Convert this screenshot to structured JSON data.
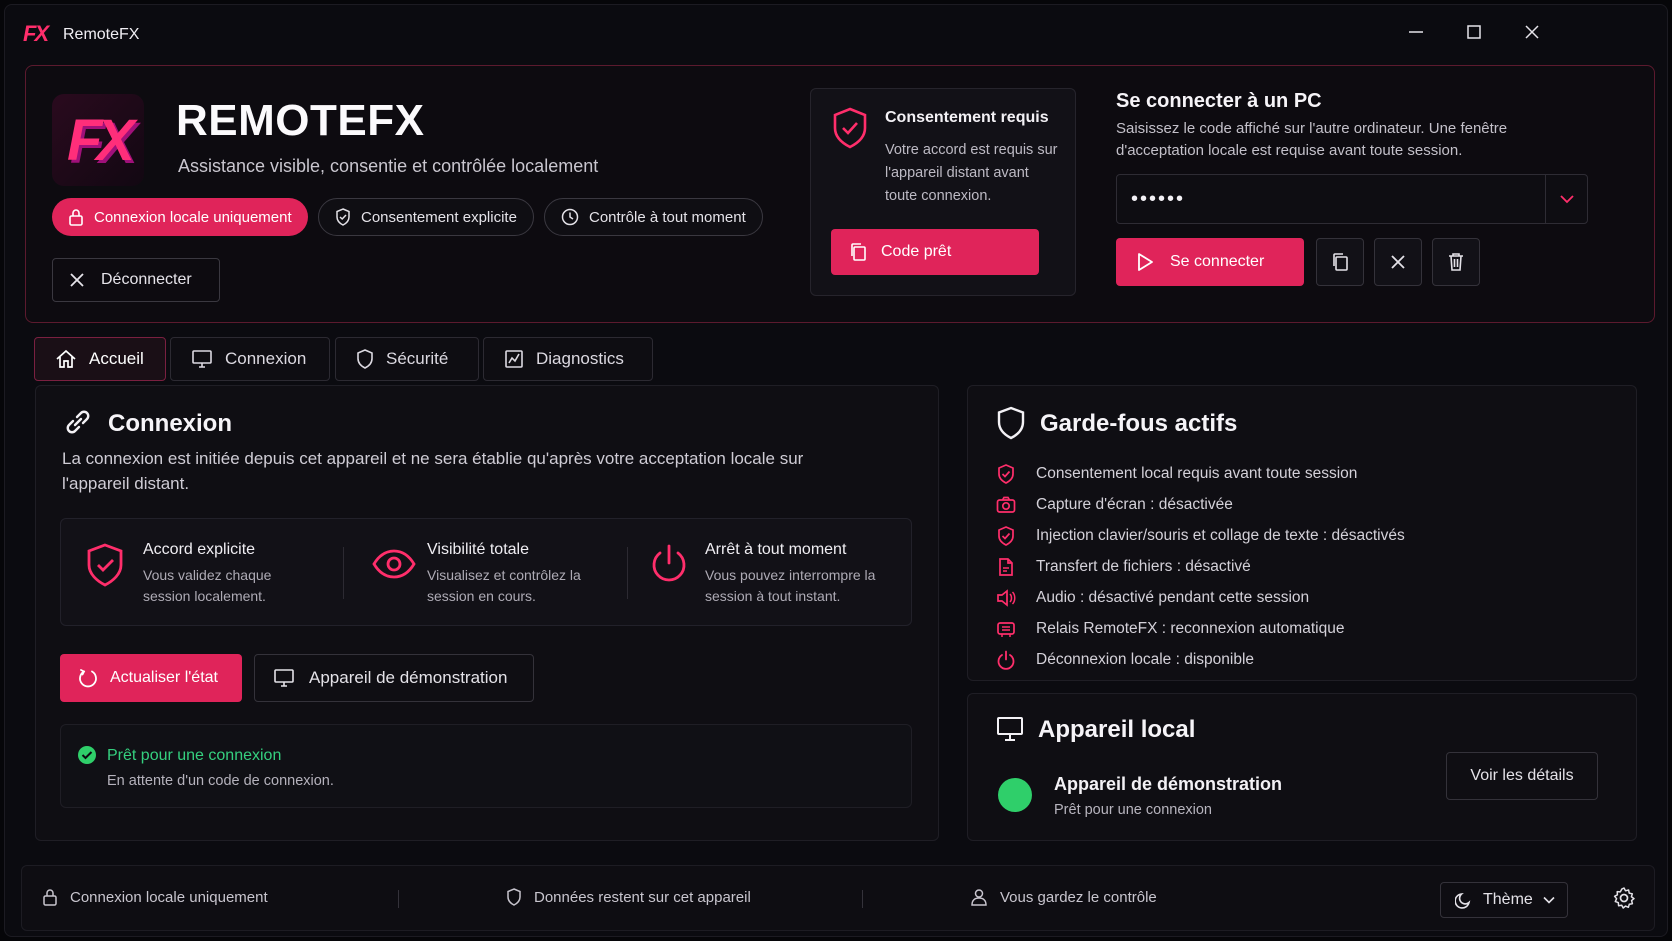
{
  "window": {
    "title": "RemoteFX",
    "logo_text": "FX"
  },
  "hero": {
    "logo_text": "FX",
    "brand": "REMOTEFX",
    "tagline": "Assistance visible, consentie et contrôlée localement",
    "pills": [
      "Connexion locale uniquement",
      "Consentement explicite",
      "Contrôle à tout moment"
    ],
    "disconnect_label": "Déconnecter"
  },
  "consent": {
    "title": "Consentement requis",
    "desc": "Votre accord est requis sur l'appareil distant avant toute connexion.",
    "code_button": "Code prêt"
  },
  "connect": {
    "title": "Se connecter à un PC",
    "desc": "Saisissez le code affiché sur l'autre ordinateur. Une fenêtre d'acceptation locale est requise avant toute session.",
    "code_value": "••••••",
    "button": "Se connecter"
  },
  "tabs": [
    "Accueil",
    "Connexion",
    "Sécurité",
    "Diagnostics"
  ],
  "connexion_panel": {
    "title": "Connexion",
    "desc": "La connexion est initiée depuis cet appareil et ne sera établie qu'après votre acceptation locale sur l'appareil distant.",
    "features": [
      {
        "title": "Accord explicite",
        "line1": "Vous validez chaque",
        "line2": "session localement."
      },
      {
        "title": "Visibilité totale",
        "line1": "Visualisez et contrôlez la",
        "line2": "session en cours."
      },
      {
        "title": "Arrêt à tout moment",
        "line1": "Vous pouvez interrompre la",
        "line2": "session à tout instant."
      }
    ],
    "refresh_button": "Actualiser l'état",
    "demo_button": "Appareil de démonstration",
    "status_main": "Prêt pour une connexion",
    "status_sub": "En attente d'un code de connexion."
  },
  "guards": {
    "title": "Garde-fous actifs",
    "items": [
      "Consentement local requis avant toute session",
      "Capture d'écran : désactivée",
      "Injection clavier/souris et collage de texte : désactivés",
      "Transfert de fichiers : désactivé",
      "Audio : désactivé pendant cette session",
      "Relais RemoteFX : reconnexion automatique",
      "Déconnexion locale : disponible"
    ]
  },
  "local_device": {
    "title": "Appareil local",
    "name": "Appareil de démonstration",
    "status": "Prêt pour une connexion",
    "details_button": "Voir les détails"
  },
  "footer": {
    "items": [
      "Connexion locale uniquement",
      "Données restent sur cet appareil",
      "Vous gardez le contrôle"
    ],
    "theme_label": "Thème"
  },
  "colors": {
    "accent": "#e0245a",
    "success": "#2fcf6a",
    "background": "#0b0b10"
  }
}
